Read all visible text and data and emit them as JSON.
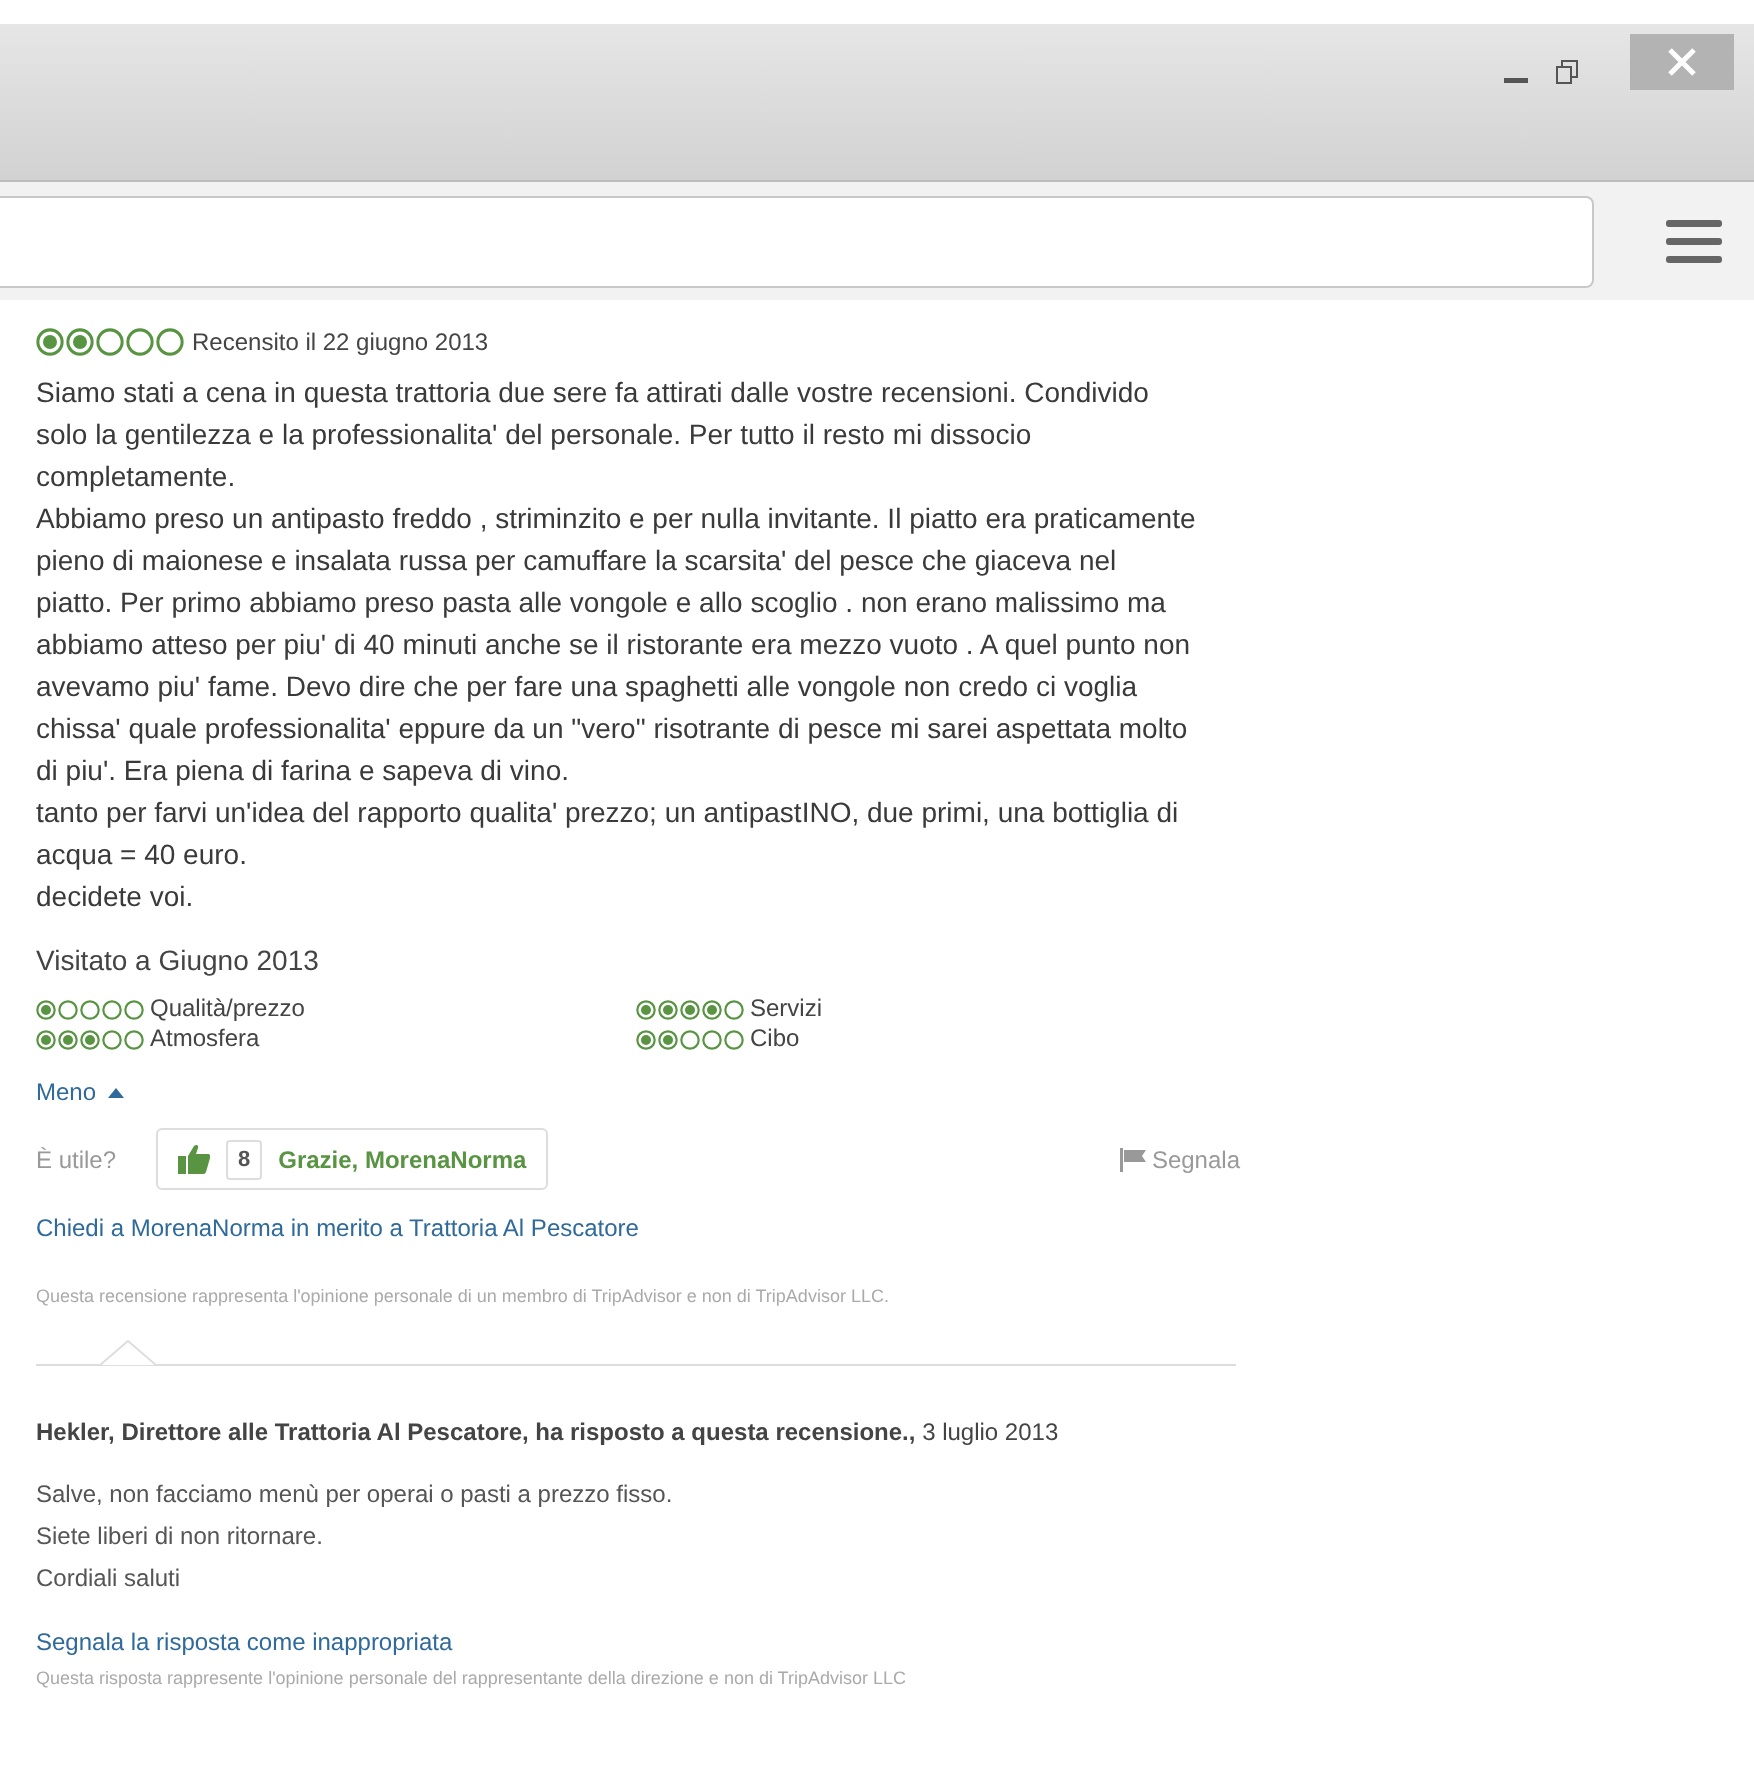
{
  "review": {
    "stars": 2,
    "date": "Recensito il 22 giugno 2013",
    "paragraphs": [
      "Siamo stati a cena in questa trattoria due sere fa attirati dalle vostre recensioni. Condivido solo la gentilezza e la professionalita' del personale. Per tutto il resto mi dissocio completamente.",
      "Abbiamo preso un antipasto freddo , striminzito e per nulla invitante. Il piatto era praticamente pieno di maionese e insalata russa per camuffare la scarsita' del pesce che giaceva nel piatto. Per primo abbiamo preso pasta alle vongole e allo scoglio . non erano malissimo ma abbiamo atteso per piu' di 40 minuti anche se il ristorante era mezzo vuoto . A quel punto non avevamo piu' fame. Devo dire che per fare una spaghetti alle vongole non credo ci voglia chissa' quale professionalita' eppure da un \"vero\" risotrante di pesce mi sarei aspettata molto di piu'. Era piena di farina e sapeva di vino.",
      "tanto per farvi un'idea del rapporto qualita' prezzo; un antipastINO, due primi, una bottiglia di acqua = 40 euro.",
      "decidete voi."
    ],
    "visited": "Visitato a Giugno 2013",
    "ratings": [
      {
        "label": "Qualità/prezzo",
        "stars": 1
      },
      {
        "label": "Servizi",
        "stars": 4
      },
      {
        "label": "Atmosfera",
        "stars": 3
      },
      {
        "label": "Cibo",
        "stars": 2
      }
    ],
    "less_link": "Meno",
    "helpful_label": "È utile?",
    "thanks_count": "8",
    "thanks_button": "Grazie, MorenaNorma",
    "report": "Segnala",
    "ask_link": "Chiedi a MorenaNorma in merito a Trattoria Al Pescatore",
    "disclaimer": "Questa recensione rappresenta l'opinione personale di un membro di TripAdvisor e non di TripAdvisor LLC."
  },
  "response": {
    "header": "**Hekler, Direttore alle Trattoria Al Pescatore, ha risposto a questa recensione.,** 3 luglio 2013",
    "lines": [
      "Salve, non facciamo menù per operai o pasti a prezzo fisso.",
      "Siete liberi di non ritornare.",
      "Cordiali saluti"
    ],
    "report_link": "Segnala la risposta come inappropriata",
    "disclaimer": "Questa risposta rappresente l'opinione personale del rappresentante della direzione e non di TripAdvisor LLC"
  }
}
